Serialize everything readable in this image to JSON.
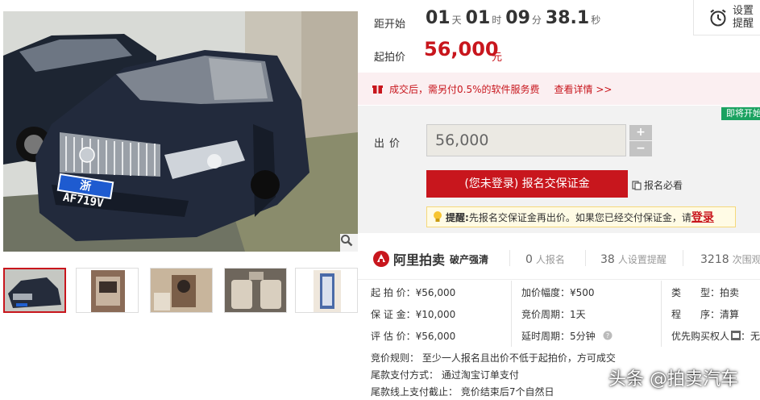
{
  "countdown": {
    "label": "距开始",
    "days": "01",
    "days_unit": "天",
    "hours": "01",
    "hours_unit": "时",
    "minutes": "09",
    "minutes_unit": "分",
    "seconds": "38.1",
    "seconds_unit": "秒"
  },
  "reminder": {
    "label": "设置提醒",
    "icon": "alarm-clock-icon"
  },
  "starting_price": {
    "label": "起拍价",
    "value": "56,000",
    "unit": "元"
  },
  "service_notice": {
    "text": "成交后，需另付0.5%的软件服务费",
    "link": "查看详情 >>"
  },
  "bid": {
    "status_tag": "即将开始",
    "label": "出价",
    "value": "56,000",
    "increase": "+",
    "decrease": "−",
    "register_button": "(您未登录) 报名交保证金",
    "must_read": "报名必看",
    "tip_prefix": "提醒:",
    "tip_text": "先报名交保证金再出价。如果您已经交付保证金，请",
    "tip_login": "登录"
  },
  "brand": {
    "name": "阿里拍卖",
    "sub": "破产强清",
    "registered_count": "0",
    "registered_label": "人报名",
    "reminders_count": "38",
    "reminders_label": "人设置提醒",
    "views_count": "3218",
    "views_label": "次围观"
  },
  "params": {
    "col1": [
      "起 拍 价：¥56,000",
      "保 证 金：¥10,000",
      "评 估 价：¥56,000"
    ],
    "col2": [
      "加价幅度：¥500",
      "竞价周期：1天",
      "延时周期：5分钟"
    ],
    "col3": [
      "类　　型：拍卖",
      "程　　序：清算",
      "优先购买权人"
    ],
    "col3_tail": "：无"
  },
  "rules": [
    "竞价规则：   至少一人报名且出价不低于起拍价，方可成交",
    "尾款支付方式：   通过淘宝订单支付",
    "尾款线上支付截止：   竞价结束后7个自然日"
  ],
  "photo": {
    "plate": "浙AF719V"
  },
  "watermark": "头条 @拍卖汽车",
  "colors": {
    "accent": "#c8161d",
    "tag_green": "#1aa260",
    "panel_gray": "#f2f2f2"
  }
}
